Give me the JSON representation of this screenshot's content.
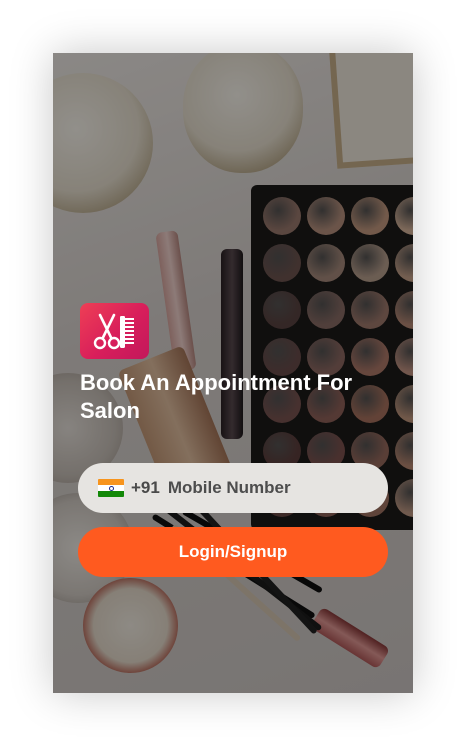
{
  "app": {
    "logo_icon": "scissors-comb-icon",
    "title": "Book An Appointment For Salon"
  },
  "login": {
    "country_flag_icon": "india-flag-icon",
    "country_code": "+91",
    "mobile_placeholder": "Mobile Number",
    "mobile_value": "",
    "submit_label": "Login/Signup"
  },
  "colors": {
    "accent": "#ff5a1f",
    "logo_gradient_start": "#ee3f55",
    "logo_gradient_end": "#c2185b",
    "input_background": "#e6e4e1"
  }
}
